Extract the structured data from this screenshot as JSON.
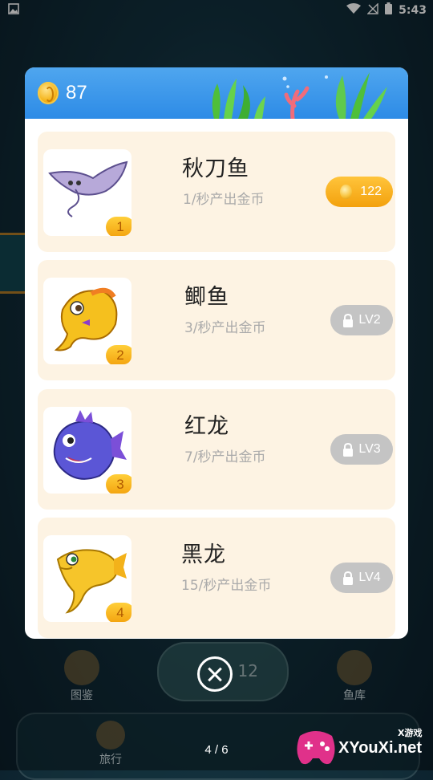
{
  "status_bar": {
    "time": "5:43"
  },
  "background": {
    "nav_items": [
      "图鉴",
      "鱼库",
      "旅行"
    ],
    "pill_number": "12"
  },
  "modal": {
    "gold_amount": "87",
    "fish": [
      {
        "name": "秋刀鱼",
        "rate": "1/秒产出金币",
        "level": "1",
        "action": "buy",
        "price": "122"
      },
      {
        "name": "鲫鱼",
        "rate": "3/秒产出金币",
        "level": "2",
        "action": "locked",
        "required": "LV2"
      },
      {
        "name": "红龙",
        "rate": "7/秒产出金币",
        "level": "3",
        "action": "locked",
        "required": "LV3"
      },
      {
        "name": "黑龙",
        "rate": "15/秒产出金币",
        "level": "4",
        "action": "locked",
        "required": "LV4"
      }
    ]
  },
  "page_indicator": "4 / 6",
  "watermark": {
    "text": "XYouXi.net",
    "small": "X游戏"
  },
  "colors": {
    "header_blue": "#2d8be6",
    "card_bg": "#fdf3e3",
    "gold": "#f3a10d",
    "locked_gray": "#c4c4c4"
  }
}
